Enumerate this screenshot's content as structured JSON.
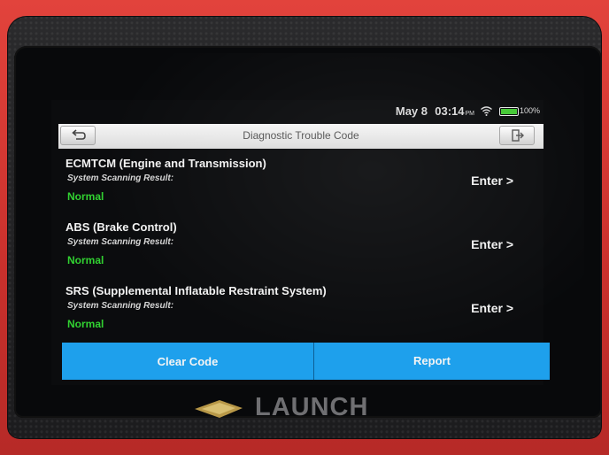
{
  "status_bar": {
    "date": "May 8",
    "time": "03:14",
    "ampm": "PM",
    "battery": "100%",
    "battery_level": 1.0
  },
  "header": {
    "title": "Diagnostic Trouble Code",
    "back_icon": "back-arrow-icon",
    "exit_icon": "exit-icon"
  },
  "systems": [
    {
      "name": "ECMTCM (Engine and Transmission)",
      "scan_label": "System Scanning Result:",
      "status": "Normal",
      "action": "Enter >"
    },
    {
      "name": "ABS (Brake Control)",
      "scan_label": "System Scanning Result:",
      "status": "Normal",
      "action": "Enter >"
    },
    {
      "name": "SRS (Supplemental Inflatable Restraint System)",
      "scan_label": "System Scanning Result:",
      "status": "Normal",
      "action": "Enter >"
    }
  ],
  "actions": {
    "clear": "Clear Code",
    "report": "Report"
  },
  "brand": {
    "name": "LAUNCH"
  },
  "colors": {
    "status_normal": "#31d131",
    "action_bar": "#1ea0ec",
    "battery_fill": "#43c833",
    "housing": "#d63a34"
  }
}
